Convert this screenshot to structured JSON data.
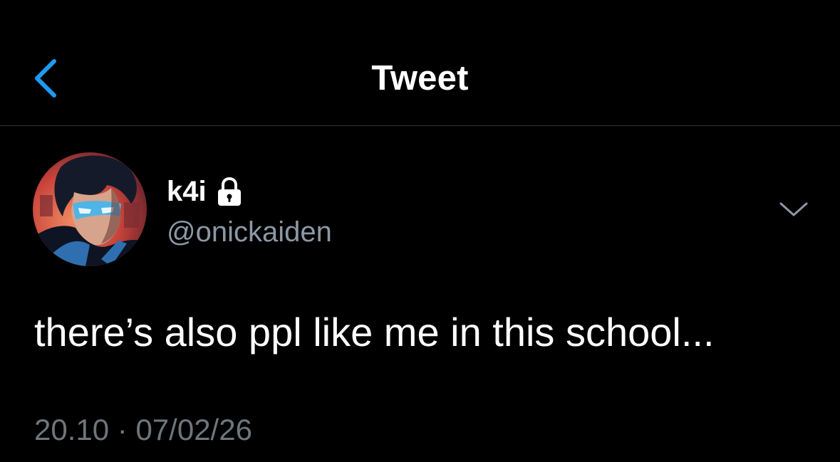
{
  "header": {
    "title": "Tweet",
    "back_icon": "chevron-left-icon"
  },
  "tweet": {
    "author": {
      "display_name": "k4i",
      "protected_icon": "lock-icon",
      "handle": "@onickaiden"
    },
    "more_icon": "chevron-down-icon",
    "text": "there’s also ppl like me in this school...",
    "time": "20.10",
    "separator": "·",
    "date": "07/02/26"
  },
  "colors": {
    "background": "#000000",
    "accent": "#1d9bf0",
    "secondary_text": "#8b98a5",
    "divider": "#2f3336"
  }
}
